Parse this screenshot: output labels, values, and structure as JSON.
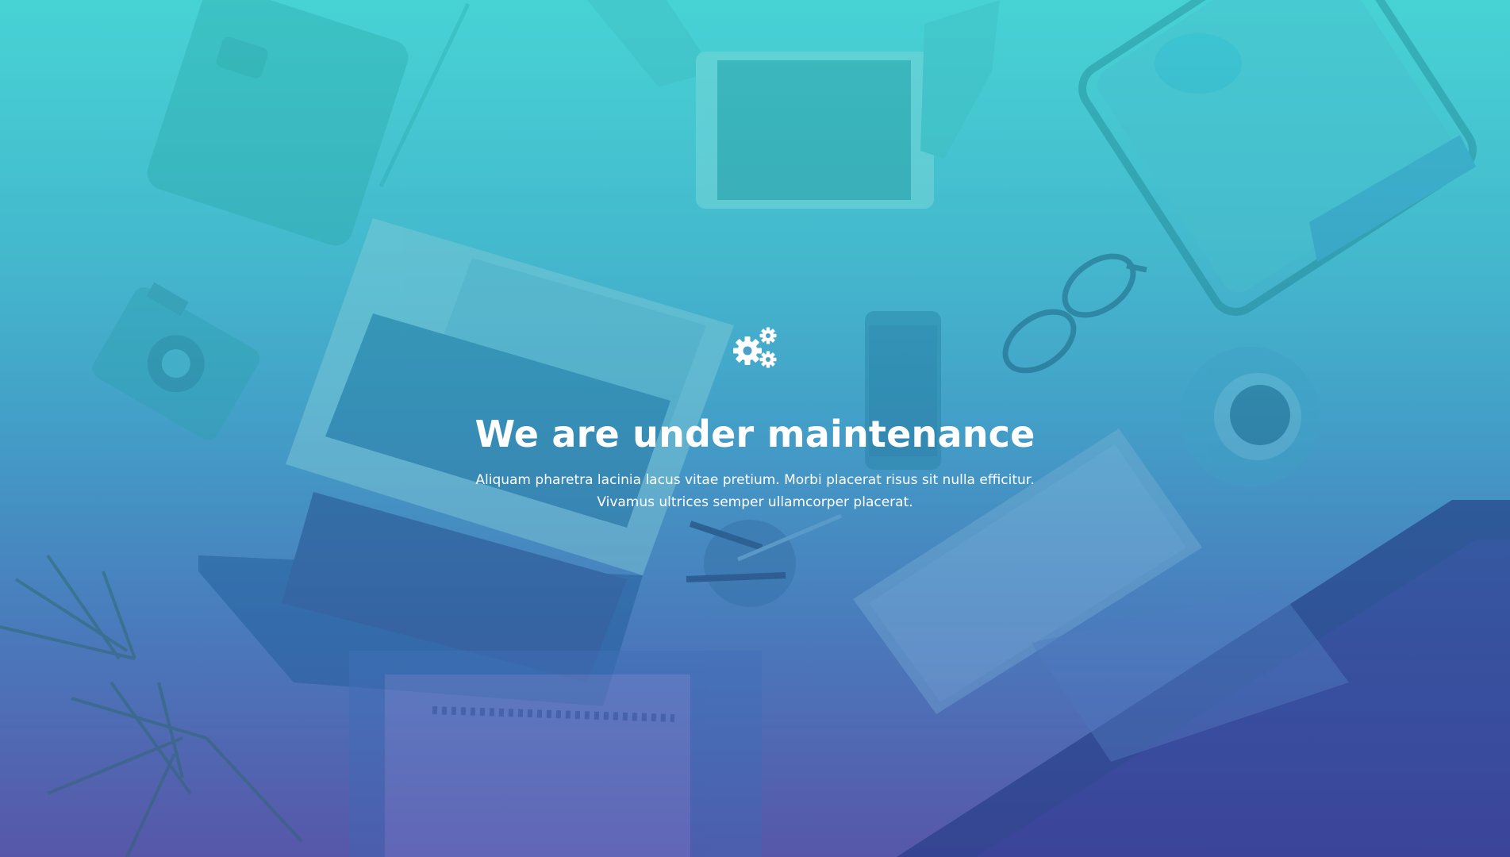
{
  "maintenance": {
    "icon": "gears-icon",
    "title": "We are under maintenance",
    "description_line1": "Aliquam pharetra lacinia lacus vitae pretium. Morbi placerat risus sit nulla efficitur.",
    "description_line2": "Vivamus ultrices semper ullamcorper placerat."
  },
  "colors": {
    "gradient_top": "#47d0d3",
    "gradient_bottom": "#5a5aa8",
    "text": "#ffffff"
  }
}
